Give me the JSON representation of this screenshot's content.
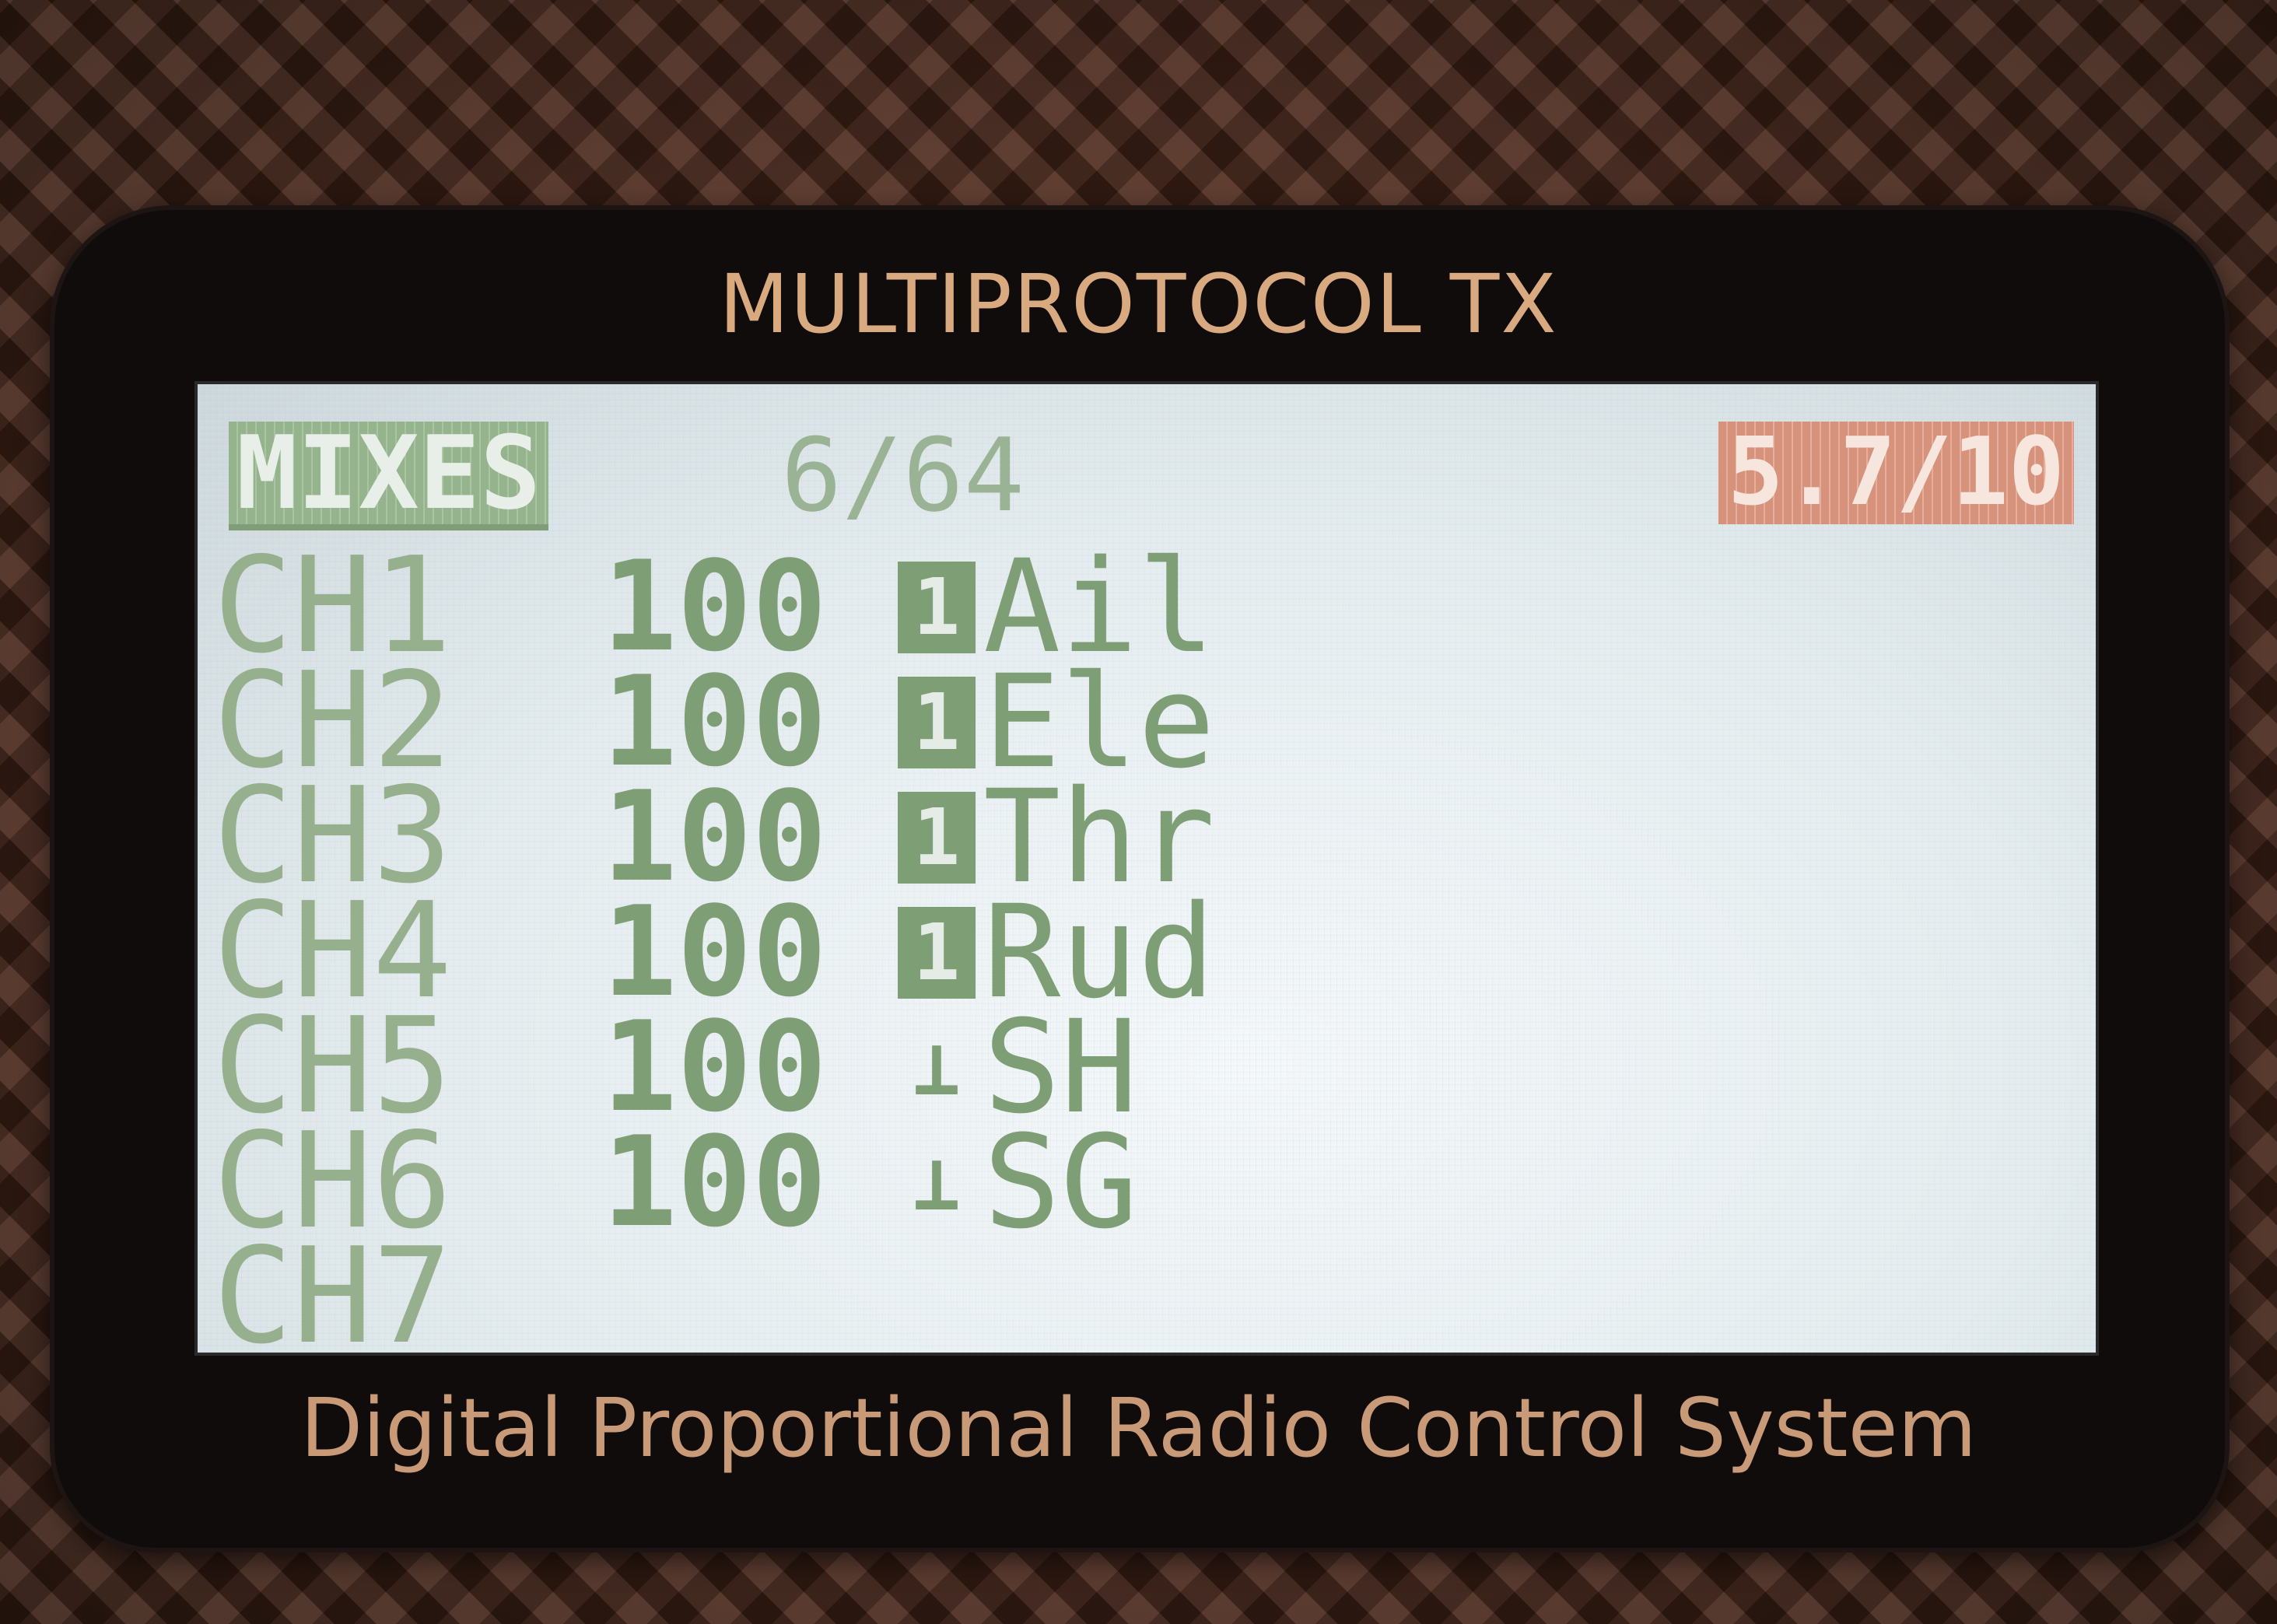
{
  "device": {
    "brand_top": "MULTIPROTOCOL TX",
    "brand_bottom": "Digital Proportional Radio Control System"
  },
  "screen": {
    "title": "MIXES",
    "page": "6/64",
    "battery": "5.7/10"
  },
  "channels": [
    {
      "name": "CH1",
      "weight": "100",
      "source_icon": "stick-icon",
      "source_glyph": "1",
      "source": "Ail"
    },
    {
      "name": "CH2",
      "weight": "100",
      "source_icon": "stick-icon",
      "source_glyph": "1",
      "source": "Ele"
    },
    {
      "name": "CH3",
      "weight": "100",
      "source_icon": "stick-icon",
      "source_glyph": "1",
      "source": "Thr"
    },
    {
      "name": "CH4",
      "weight": "100",
      "source_icon": "stick-icon",
      "source_glyph": "1",
      "source": "Rud"
    },
    {
      "name": "CH5",
      "weight": "100",
      "source_icon": "switch-icon",
      "source_glyph": "⊥",
      "source": "SH"
    },
    {
      "name": "CH6",
      "weight": "100",
      "source_icon": "switch-icon",
      "source_glyph": "⊥",
      "source": "SG"
    },
    {
      "name": "CH7",
      "weight": "",
      "source_icon": "",
      "source_glyph": "",
      "source": ""
    }
  ],
  "colors": {
    "lcd_background": "#e4ecef",
    "lcd_text": "#8aa883",
    "battery_highlight": "#d7927c",
    "brand_text": "#d9a97f"
  }
}
